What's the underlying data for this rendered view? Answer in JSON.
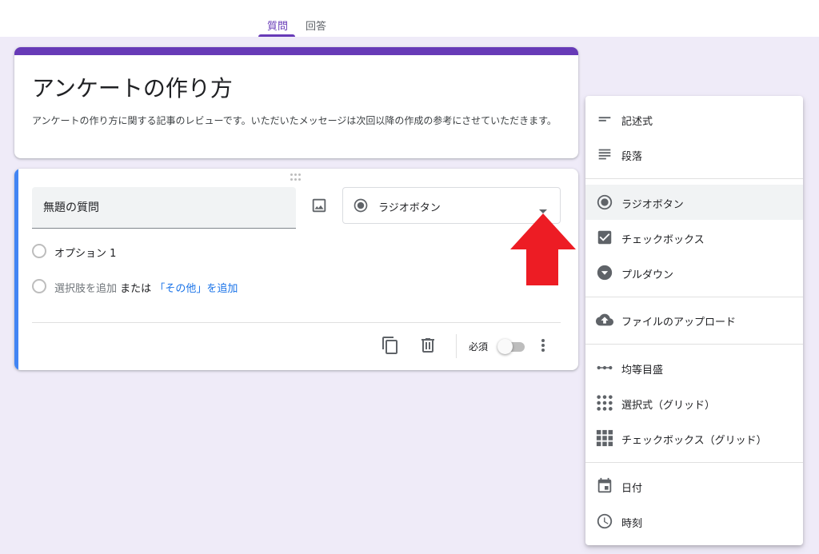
{
  "tabs": {
    "questions": "質問",
    "responses": "回答"
  },
  "form": {
    "title": "アンケートの作り方",
    "description": "アンケートの作り方に関する記事のレビューです。いただいたメッセージは次回以降の作成の参考にさせていただきます。"
  },
  "question": {
    "title": "無題の質問",
    "type_selected": "ラジオボタン",
    "options": [
      "オプション 1"
    ],
    "add_option": "選択肢を追加",
    "or": "または",
    "add_other": "「その他」を追加",
    "required_label": "必須",
    "required": false
  },
  "menu": {
    "items": [
      {
        "label": "記述式",
        "icon": "short-text-icon"
      },
      {
        "label": "段落",
        "icon": "paragraph-icon"
      },
      {
        "label": "ラジオボタン",
        "icon": "radio-button-icon"
      },
      {
        "label": "チェックボックス",
        "icon": "checkbox-icon"
      },
      {
        "label": "プルダウン",
        "icon": "dropdown-icon"
      },
      {
        "label": "ファイルのアップロード",
        "icon": "cloud-upload-icon"
      },
      {
        "label": "均等目盛",
        "icon": "linear-scale-icon"
      },
      {
        "label": "選択式（グリッド）",
        "icon": "grid-dots-icon"
      },
      {
        "label": "チェックボックス（グリッド）",
        "icon": "grid-squares-icon"
      },
      {
        "label": "日付",
        "icon": "calendar-icon"
      },
      {
        "label": "時刻",
        "icon": "clock-icon"
      }
    ]
  },
  "colors": {
    "accent": "#673ab7",
    "active_question": "#4285f4",
    "link": "#1a73e8",
    "annotation_arrow": "#ed1c24",
    "background": "#efebf8"
  }
}
